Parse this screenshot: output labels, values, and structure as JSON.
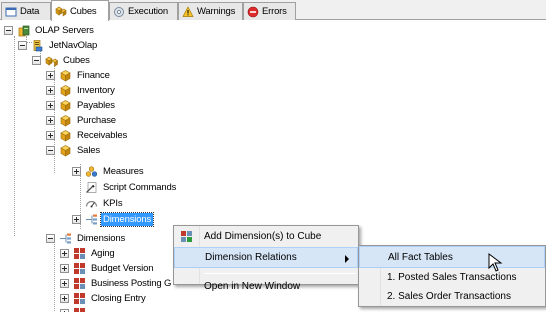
{
  "tabs": [
    {
      "label": "Data",
      "icon": "data-icon",
      "active": false
    },
    {
      "label": "Cubes",
      "icon": "cubes-icon",
      "active": true
    },
    {
      "label": "Execution",
      "icon": "execution-icon",
      "active": false
    },
    {
      "label": "Warnings",
      "icon": "warning-icon",
      "active": false
    },
    {
      "label": "Errors",
      "icon": "error-icon",
      "active": false
    }
  ],
  "tree": {
    "olap_servers": "OLAP Servers",
    "server": "JetNavOlap",
    "cubes_folder": "Cubes",
    "cubes": [
      "Finance",
      "Inventory",
      "Payables",
      "Purchase",
      "Receivables",
      "Sales"
    ],
    "sales_children": [
      "Measures",
      "Script Commands",
      "KPIs",
      "Dimensions"
    ],
    "dimensions_folder": "Dimensions",
    "dimensions": [
      "Aging",
      "Budget Version",
      "Business Posting G",
      "Closing Entry"
    ]
  },
  "context_menu": {
    "items": [
      {
        "label": "Add Dimension(s) to Cube",
        "icon": "add-dimension-icon"
      },
      {
        "label": "Dimension Relations",
        "has_submenu": true,
        "highlighted": true
      },
      {
        "label": "Open in New Window"
      }
    ]
  },
  "submenu": {
    "items": [
      {
        "label": "All Fact Tables",
        "highlighted": true
      },
      {
        "label": "1. Posted Sales Transactions"
      },
      {
        "label": "2. Sales Order Transactions"
      }
    ]
  },
  "colors": {
    "selection": "#3399ff",
    "menu_highlight": "#d6e6f7",
    "cube_gold": "#e8a317"
  }
}
